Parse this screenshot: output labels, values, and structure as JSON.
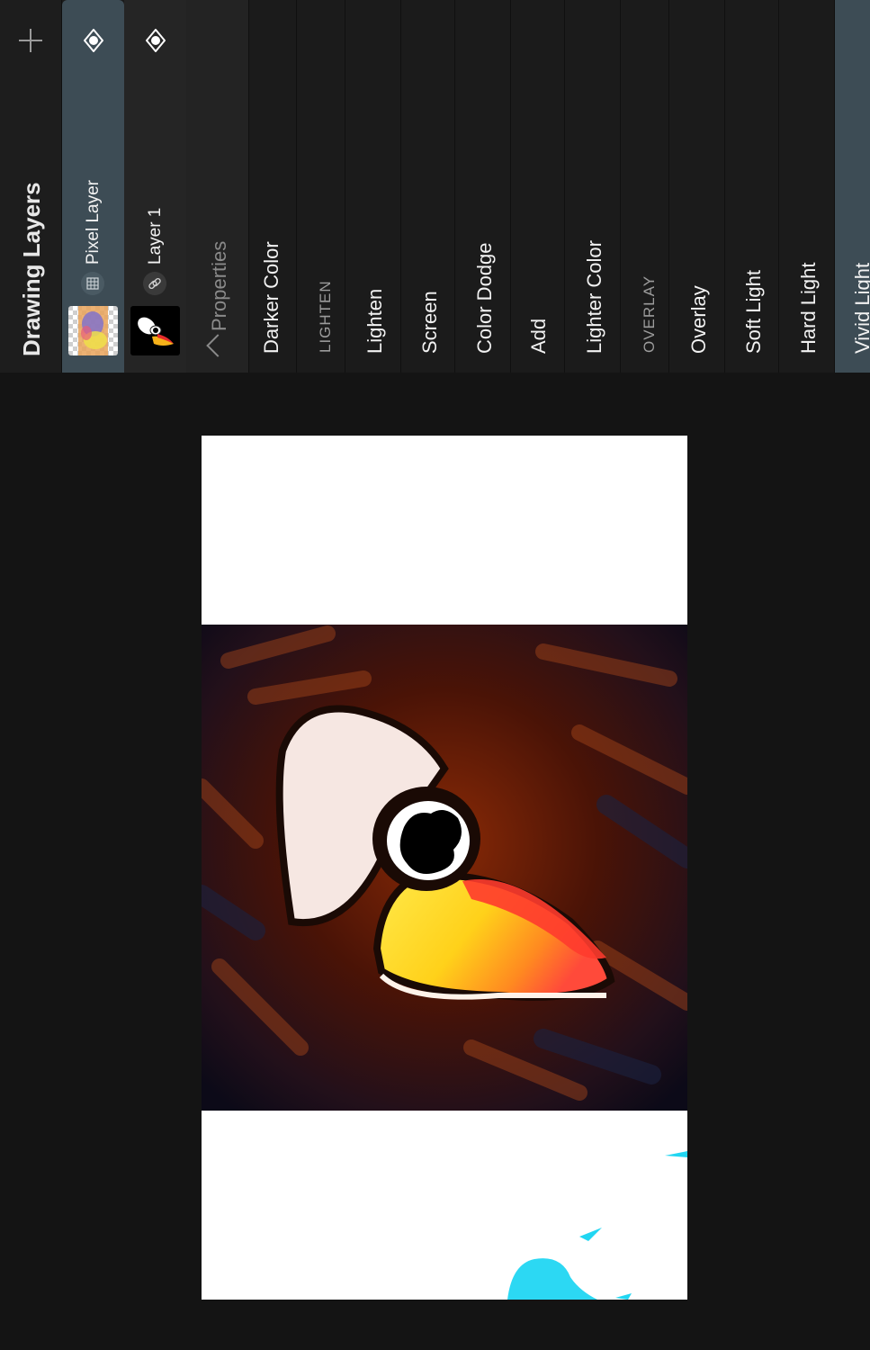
{
  "panel": {
    "title": "Drawing Layers",
    "add_icon": "plus-icon",
    "layers": [
      {
        "name": "Pixel Layer",
        "selected": true,
        "visibility_icon": "eye-visible-icon",
        "type_icon": "grid-icon"
      },
      {
        "name": "Layer 1",
        "selected": false,
        "visibility_icon": "eye-visible-icon",
        "type_icon": "link-icon"
      }
    ],
    "properties_label": "Properties",
    "blend_modes": [
      {
        "label": "Darker Color",
        "kind": "item"
      },
      {
        "label": "LIGHTEN",
        "kind": "section"
      },
      {
        "label": "Lighten",
        "kind": "item"
      },
      {
        "label": "Screen",
        "kind": "item"
      },
      {
        "label": "Color Dodge",
        "kind": "item"
      },
      {
        "label": "Add",
        "kind": "item"
      },
      {
        "label": "Lighter Color",
        "kind": "item"
      },
      {
        "label": "OVERLAY",
        "kind": "section"
      },
      {
        "label": "Overlay",
        "kind": "item"
      },
      {
        "label": "Soft Light",
        "kind": "item"
      },
      {
        "label": "Hard Light",
        "kind": "item"
      },
      {
        "label": "Vivid Light",
        "kind": "item",
        "selected": true
      }
    ]
  },
  "colors": {
    "background": "#141414",
    "panel": "#1b1b1b",
    "selection": "#3d4c55"
  }
}
